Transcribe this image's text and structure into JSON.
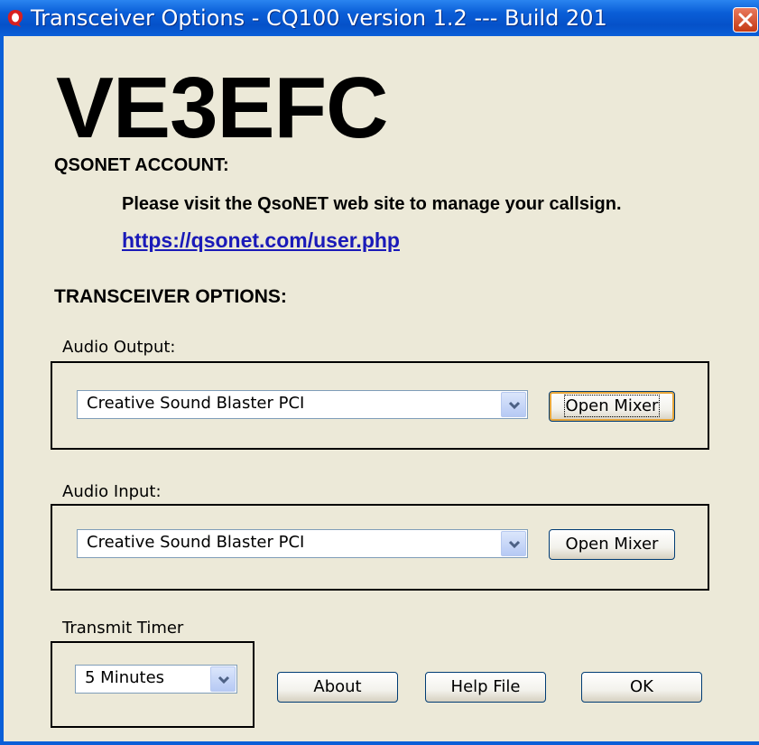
{
  "window": {
    "title": "Transceiver  Options - CQ100 version 1.2 --- Build 201"
  },
  "callsign": "VE3EFC",
  "qsonet": {
    "heading": "QSONET ACCOUNT:",
    "message": "Please visit the QsoNET web site to manage your callsign.",
    "link": "https://qsonet.com/user.php"
  },
  "transceiver": {
    "heading": "TRANSCEIVER OPTIONS:",
    "audio_output": {
      "label": "Audio Output:",
      "selected": "Creative Sound Blaster PCI",
      "mixer_button": "Open Mixer"
    },
    "audio_input": {
      "label": "Audio Input:",
      "selected": "Creative Sound Blaster PCI",
      "mixer_button": "Open Mixer"
    },
    "transmit_timer": {
      "label": "Transmit Timer",
      "selected": "5  Minutes"
    }
  },
  "buttons": {
    "about": "About",
    "help": "Help File",
    "ok": "OK"
  },
  "icons": {
    "app": "cq-logo-icon",
    "close": "close-icon",
    "dropdown": "chevron-down-icon"
  }
}
